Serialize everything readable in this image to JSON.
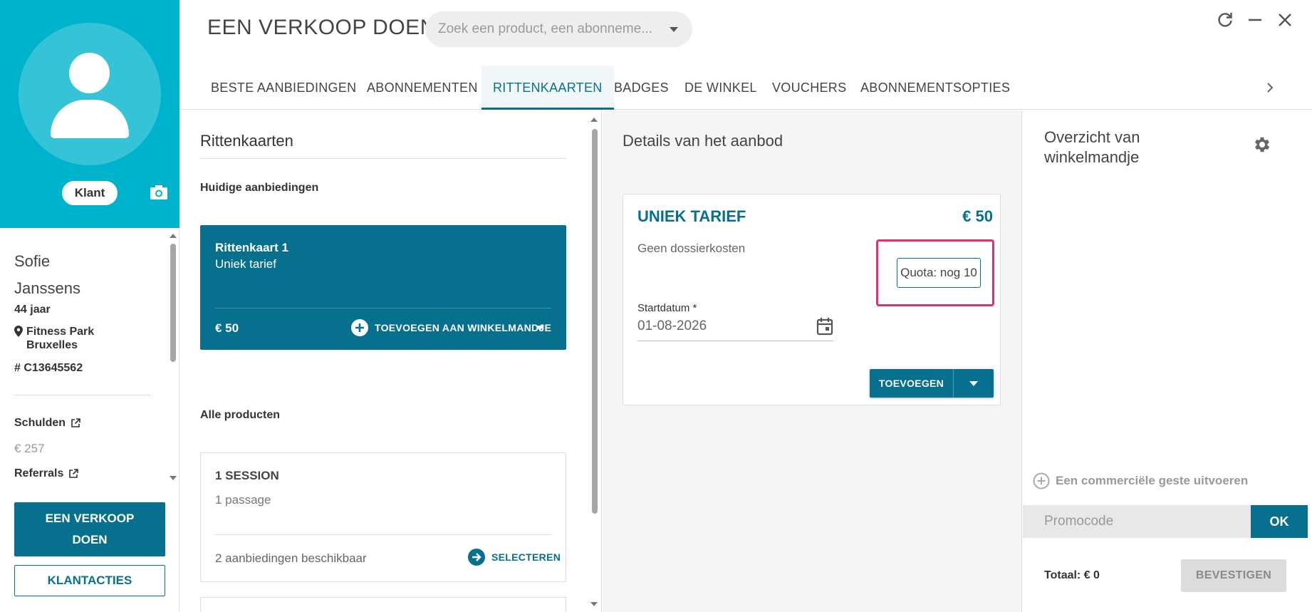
{
  "colors": {
    "primary": "#08708f",
    "hero": "#00b3cc",
    "highlight": "#e0316a"
  },
  "header": {
    "title": "EEN VERKOOP DOEN",
    "search_placeholder": "Zoek een product, een abonneme..."
  },
  "tabs": [
    {
      "label": "BESTE AANBIEDINGEN"
    },
    {
      "label": "ABONNEMENTEN"
    },
    {
      "label": "RITTENKAARTEN"
    },
    {
      "label": "BADGES"
    },
    {
      "label": "DE WINKEL"
    },
    {
      "label": "VOUCHERS"
    },
    {
      "label": "ABONNEMENTSOPTIES"
    }
  ],
  "active_tab": "RITTENKAARTEN",
  "customer": {
    "role_badge": "Klant",
    "first_name": "Sofie",
    "last_name": "Janssens",
    "age": "44 jaar",
    "club": "Fitness Park Bruxelles",
    "id": "# C13645562",
    "debts_label": "Schulden",
    "debts_value": "€ 257",
    "referrals_label": "Referrals",
    "sale_button": "EEN VERKOOP DOEN",
    "actions_button": "KLANTACTIES"
  },
  "offers": {
    "title": "Rittenkaarten",
    "current_title": "Huidige aanbiedingen",
    "active_card": {
      "name": "Rittenkaart 1",
      "subtitle": "Uniek tarief",
      "price": "€ 50",
      "add_label": "TOEVOEGEN AAN WINKELMANDJE"
    },
    "all_title": "Alle producten",
    "product_card": {
      "name": "1 SESSION",
      "subtitle": "1 passage",
      "count": "2 aanbiedingen beschikbaar",
      "select_label": "SELECTEREN"
    }
  },
  "details": {
    "title": "Details van het aanbod",
    "offer_name": "UNIEK TARIEF",
    "price": "€ 50",
    "fee": "Geen dossierkosten",
    "quota": "Quota: nog 10",
    "date_label": "Startdatum *",
    "date_value": "01-08-2026",
    "add_button": "TOEVOEGEN"
  },
  "cart": {
    "title": "Overzicht van winkelmandje",
    "gesture": "Een commerciële geste uitvoeren",
    "promo_placeholder": "Promocode",
    "ok_button": "OK",
    "total": "Totaal: € 0",
    "confirm_button": "BEVESTIGEN"
  }
}
